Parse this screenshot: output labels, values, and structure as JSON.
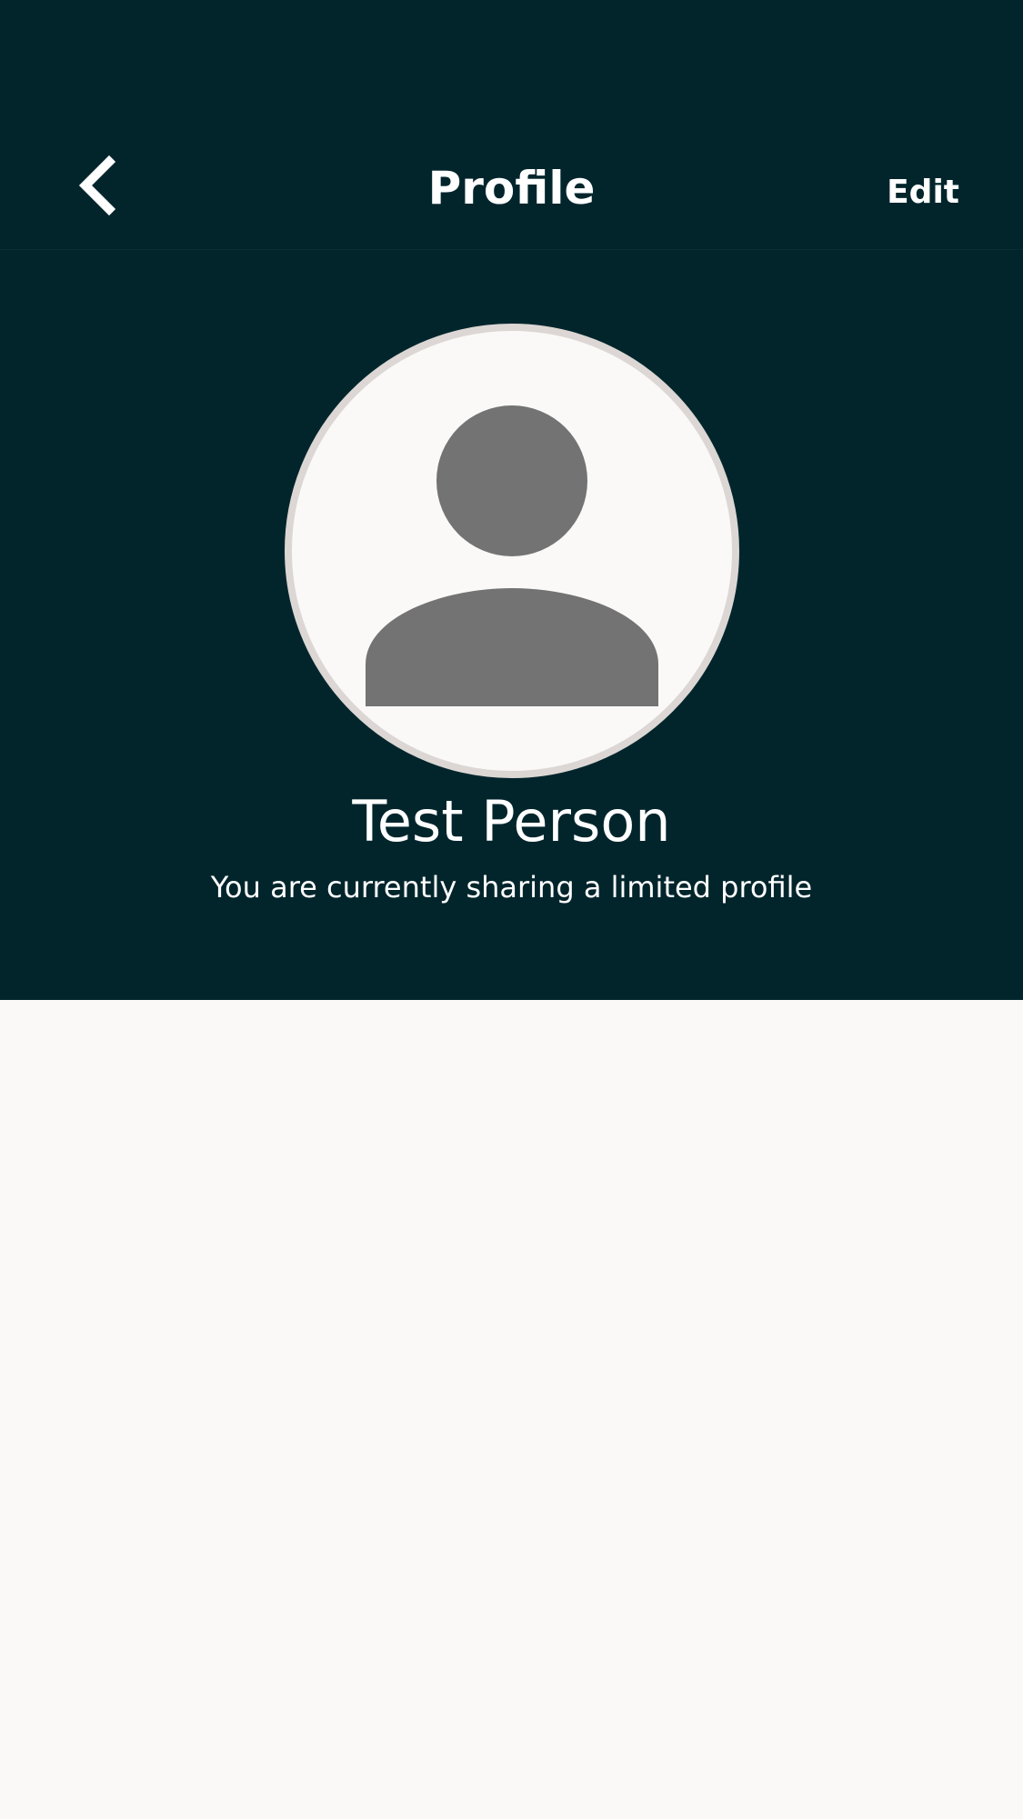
{
  "header": {
    "title": "Profile",
    "edit_label": "Edit",
    "back_icon": "chevron-left-icon"
  },
  "profile": {
    "avatar_icon": "default-avatar-icon",
    "name": "Test Person",
    "sharing_status": "You are currently sharing a limited profile"
  },
  "colors": {
    "header_background": "#02252c",
    "page_background": "#faf9f7",
    "avatar_border": "#dcd7d4",
    "avatar_figure": "#737373"
  }
}
